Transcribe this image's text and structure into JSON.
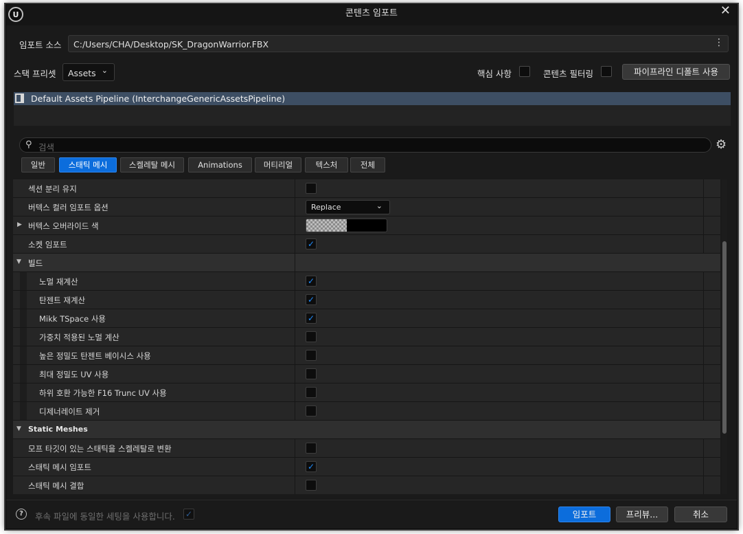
{
  "window": {
    "title": "콘텐츠 임포트"
  },
  "import_source": {
    "label": "임포트 소스",
    "value": "C:/Users/CHA/Desktop/SK_DragonWarrior.FBX"
  },
  "stack": {
    "label": "스택 프리셋",
    "value": "Assets",
    "core_label": "핵심 사항",
    "filter_label": "콘텐츠 필터링",
    "pipeline_default_button": "파이프라인 디폴트 사용"
  },
  "pipeline": {
    "selected": "Default Assets Pipeline (InterchangeGenericAssetsPipeline)"
  },
  "search": {
    "placeholder": "검색"
  },
  "tabs": [
    "일반",
    "스태틱 메시",
    "스켈레탈 메시",
    "Animations",
    "머티리얼",
    "텍스처",
    "전체"
  ],
  "rows": {
    "keep_sections": "섹션 분리 유지",
    "vertex_color_option": "버텍스 컬러 임포트 옵션",
    "vertex_color_option_value": "Replace",
    "vertex_override_color": "버텍스 오버라이드 색",
    "import_sockets": "소켓 임포트",
    "build": "빌드",
    "recompute_normals": "노멀 재계산",
    "recompute_tangents": "탄젠트 재계산",
    "mikk_tspace": "Mikk TSpace 사용",
    "weighted_normals": "가중치 적용된 노멀 계산",
    "high_precision_tangent": "높은 정밀도 탄젠트 베이시스 사용",
    "full_precision_uv": "최대 정밀도 UV 사용",
    "backwards_f16_uv": "하위 호환 가능한 F16 Trunc UV 사용",
    "remove_degenerates": "디제너레이트 제거",
    "static_meshes": "Static Meshes",
    "morph_to_skeletal": "모프 타깃이 있는 스태틱을 스켈레탈로 변환",
    "import_static_meshes": "스태틱 메시 임포트",
    "combine_static_meshes": "스태틱 메시 결합"
  },
  "footer": {
    "note": "후속 파일에 동일한 세팅을 사용합니다.",
    "import_button": "임포트",
    "preview_button": "프리뷰...",
    "cancel_button": "취소"
  },
  "icons": {
    "unreal_logo": "unreal-logo-icon",
    "close": "close-icon",
    "more": "vertical-ellipsis-icon",
    "search": "search-icon",
    "settings": "gear-icon",
    "help": "help-icon",
    "check": "checkmark-icon"
  },
  "colors": {
    "accent": "#0c6ddc",
    "selection": "#3d4e63",
    "background": "#1a1a1a"
  }
}
